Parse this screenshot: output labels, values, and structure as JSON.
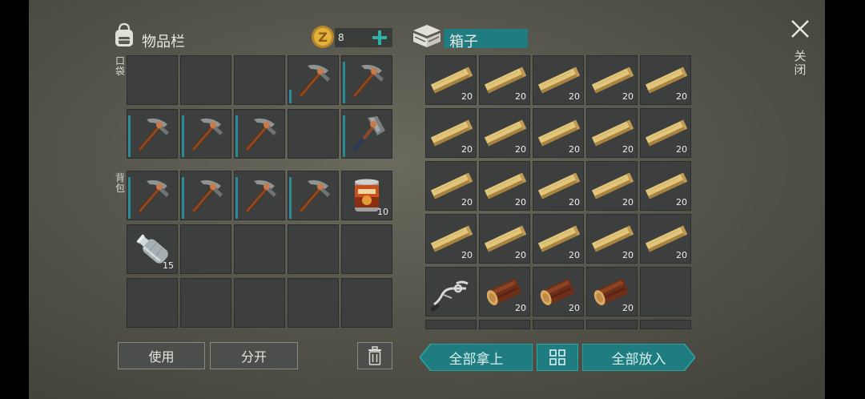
{
  "inventory": {
    "title": "物品栏",
    "coin_count": "8",
    "pocket_label": "口袋",
    "backpack_label": "背包",
    "pocket_slots": [
      {
        "icon": "empty-slot"
      },
      {
        "icon": "empty-slot"
      },
      {
        "icon": "empty-slot"
      },
      {
        "icon": "pickaxe-icon",
        "durability": 0.3
      },
      {
        "icon": "pickaxe-icon",
        "durability": 0.9
      },
      {
        "icon": "pickaxe-icon",
        "durability": 0.9
      },
      {
        "icon": "pickaxe-icon",
        "durability": 0.9
      },
      {
        "icon": "pickaxe-icon",
        "durability": 0.9
      },
      {
        "icon": "empty-slot"
      },
      {
        "icon": "hatchet-icon",
        "durability": 0.9
      }
    ],
    "backpack_slots": [
      {
        "icon": "pickaxe-icon",
        "durability": 0.9
      },
      {
        "icon": "pickaxe-icon",
        "durability": 0.9
      },
      {
        "icon": "pickaxe-icon",
        "durability": 0.9
      },
      {
        "icon": "pickaxe-icon",
        "durability": 0.9
      },
      {
        "icon": "canned-food-icon",
        "count": "10"
      },
      {
        "icon": "water-bottle-icon",
        "count": "15"
      },
      {
        "icon": "empty-slot"
      },
      {
        "icon": "empty-slot"
      },
      {
        "icon": "empty-slot"
      },
      {
        "icon": "empty-slot"
      },
      {
        "icon": "empty-slot"
      },
      {
        "icon": "empty-slot"
      },
      {
        "icon": "empty-slot"
      },
      {
        "icon": "empty-slot"
      },
      {
        "icon": "empty-slot"
      }
    ],
    "use_button": "使用",
    "split_button": "分开"
  },
  "box": {
    "title": "箱子",
    "slots": [
      {
        "icon": "wood-plank-icon",
        "count": "20"
      },
      {
        "icon": "wood-plank-icon",
        "count": "20"
      },
      {
        "icon": "wood-plank-icon",
        "count": "20"
      },
      {
        "icon": "wood-plank-icon",
        "count": "20"
      },
      {
        "icon": "wood-plank-icon",
        "count": "20"
      },
      {
        "icon": "wood-plank-icon",
        "count": "20"
      },
      {
        "icon": "wood-plank-icon",
        "count": "20"
      },
      {
        "icon": "wood-plank-icon",
        "count": "20"
      },
      {
        "icon": "wood-plank-icon",
        "count": "20"
      },
      {
        "icon": "wood-plank-icon",
        "count": "20"
      },
      {
        "icon": "wood-plank-icon",
        "count": "20"
      },
      {
        "icon": "wood-plank-icon",
        "count": "20"
      },
      {
        "icon": "wood-plank-icon",
        "count": "20"
      },
      {
        "icon": "wood-plank-icon",
        "count": "20"
      },
      {
        "icon": "wood-plank-icon",
        "count": "20"
      },
      {
        "icon": "wood-plank-icon",
        "count": "20"
      },
      {
        "icon": "wood-plank-icon",
        "count": "20"
      },
      {
        "icon": "wood-plank-icon",
        "count": "20"
      },
      {
        "icon": "wood-plank-icon",
        "count": "20"
      },
      {
        "icon": "wood-plank-icon",
        "count": "20"
      },
      {
        "icon": "handlebar-icon"
      },
      {
        "icon": "log-icon",
        "count": "20"
      },
      {
        "icon": "log-icon",
        "count": "20"
      },
      {
        "icon": "log-icon",
        "count": "20"
      },
      {
        "icon": "empty-slot"
      }
    ],
    "take_all_button": "全部拿上",
    "put_all_button": "全部放入"
  },
  "close_label": "关闭",
  "colors": {
    "teal_accent": "#1f7c80",
    "durability_bar": "#2a8a95",
    "coin_gold": "#e2b23a"
  }
}
